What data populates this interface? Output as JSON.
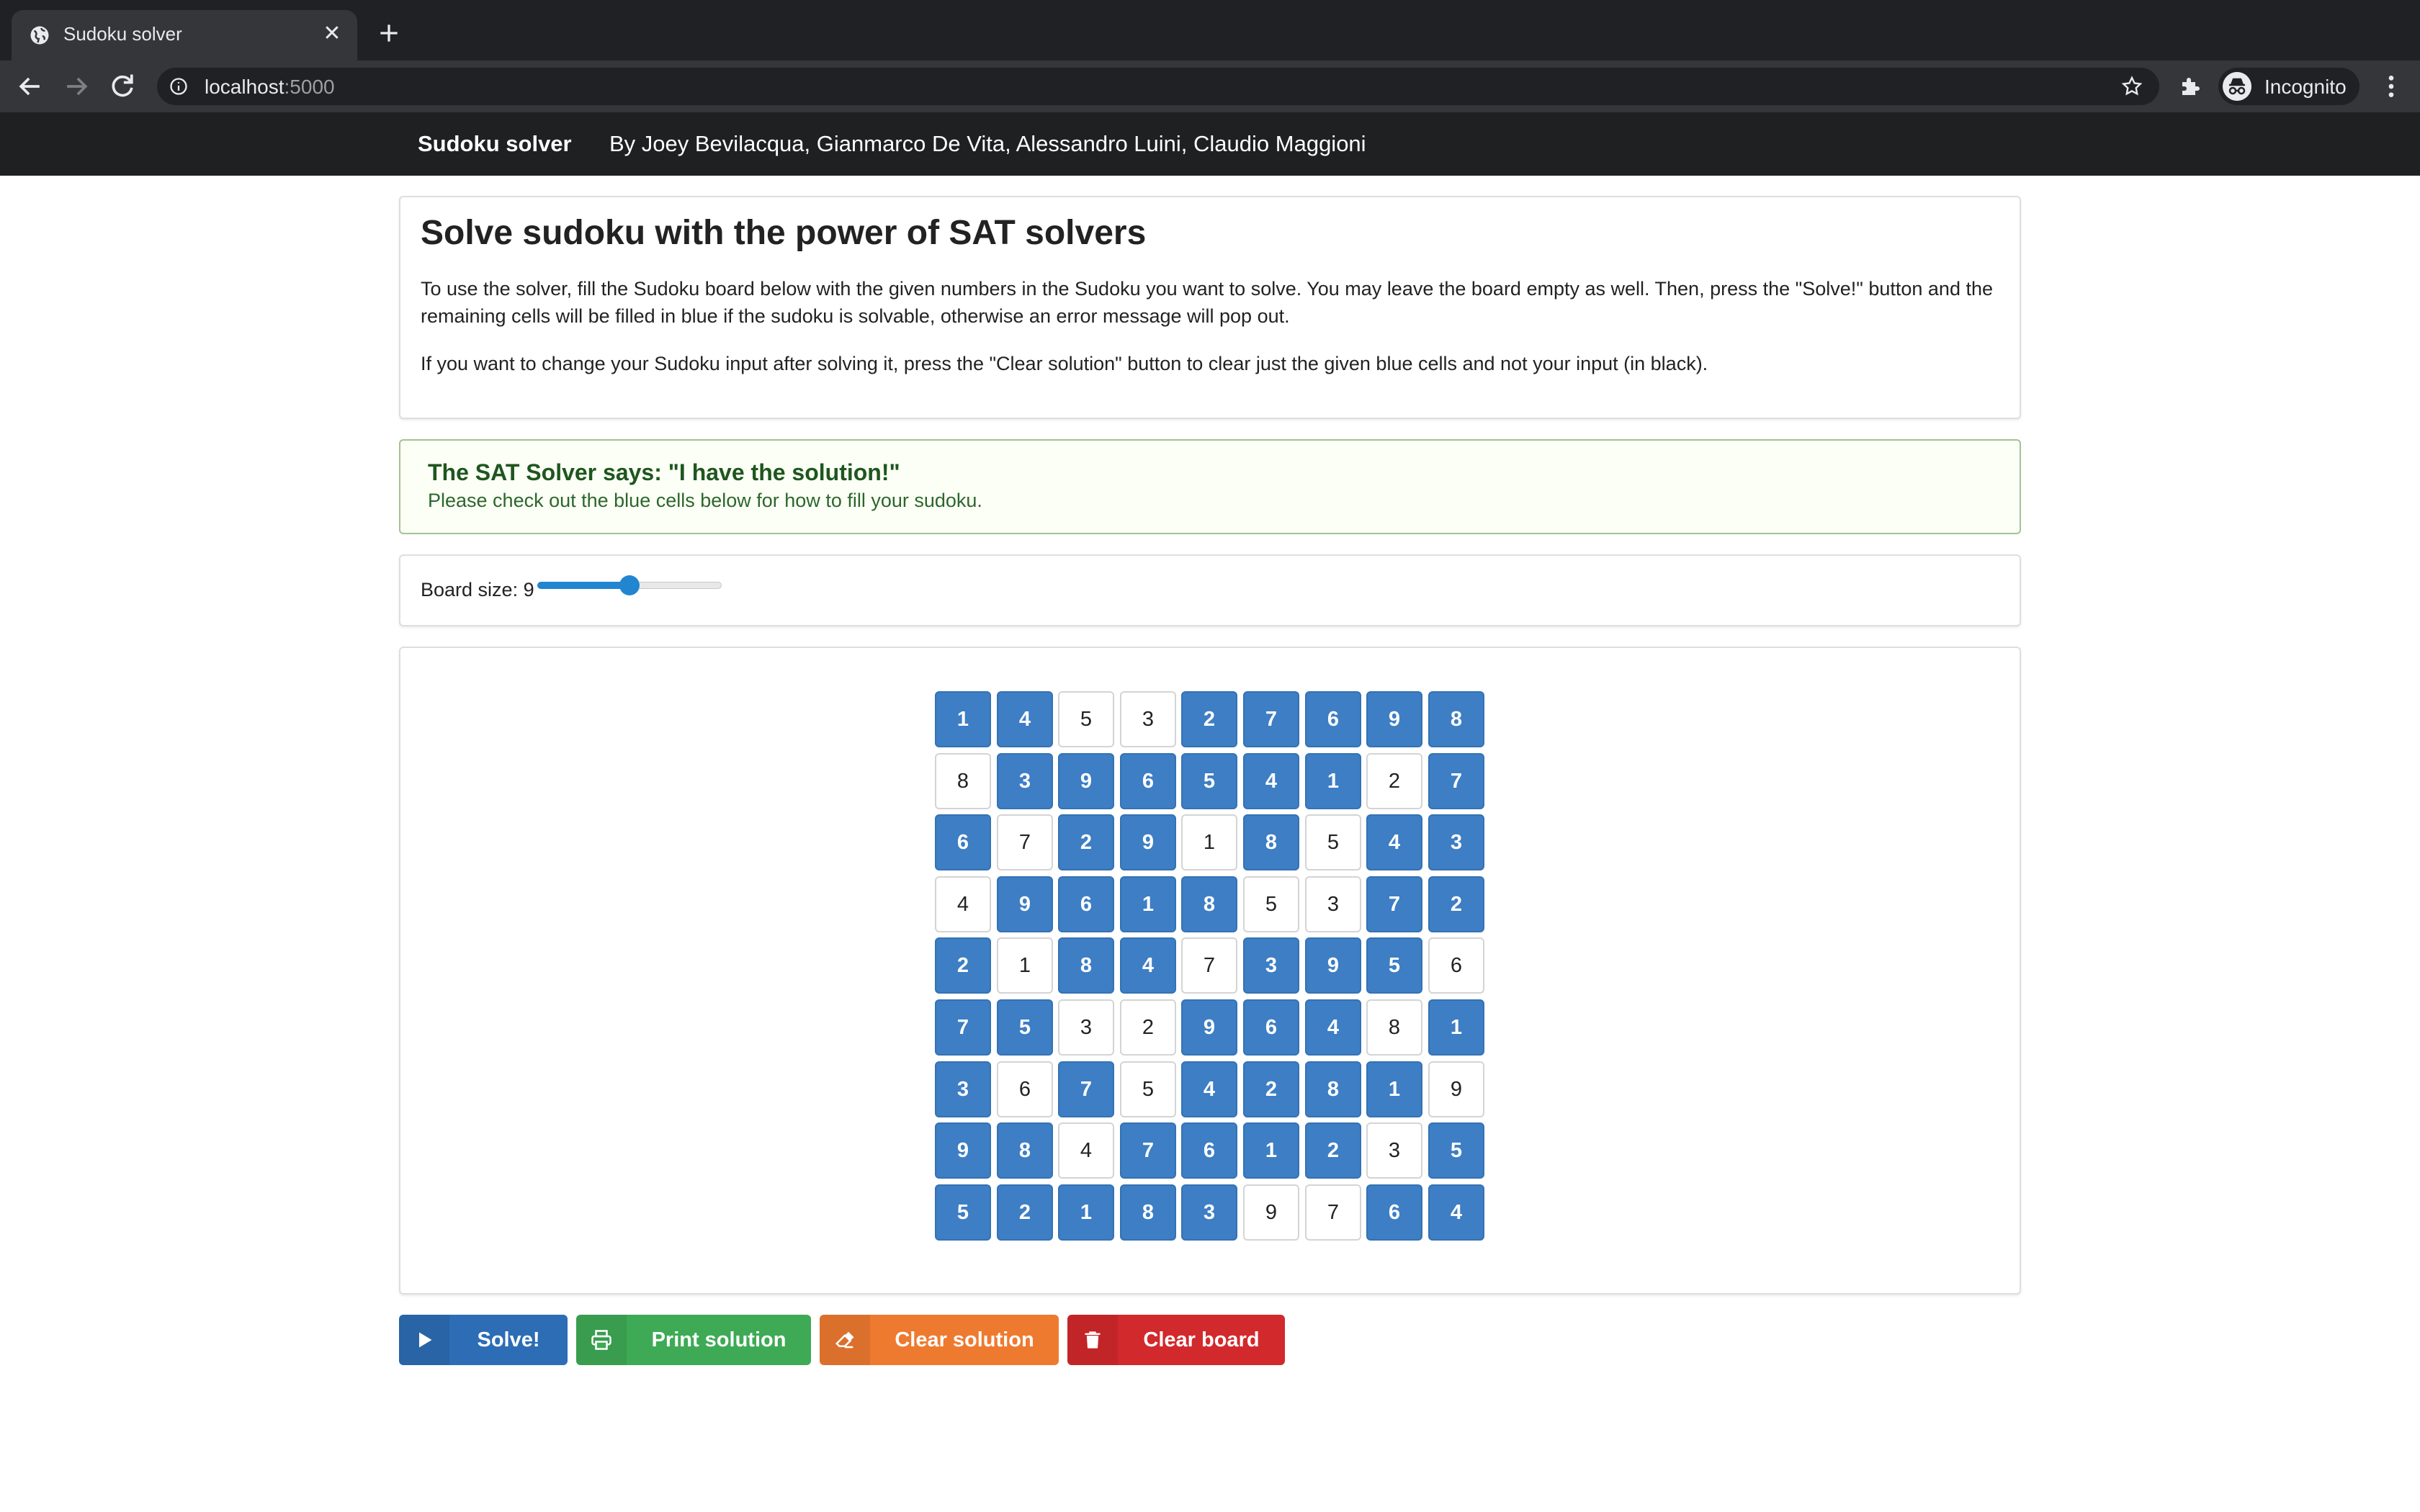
{
  "browser": {
    "tab_title": "Sudoku solver",
    "url_host": "localhost",
    "url_port": ":5000",
    "profile_label": "Incognito",
    "icons": [
      "globe-icon",
      "close-icon",
      "plus-icon",
      "back-icon",
      "forward-icon",
      "reload-icon",
      "info-icon",
      "star-icon",
      "puzzle-icon",
      "incognito-icon",
      "more-vert-icon"
    ]
  },
  "navbar": {
    "brand": "Sudoku solver",
    "authors": "By Joey Bevilacqua, Gianmarco De Vita, Alessandro Luini, Claudio Maggioni"
  },
  "intro": {
    "title": "Solve sudoku with the power of SAT solvers",
    "paragraph1": "To use the solver, fill the Sudoku board below with the given numbers in the Sudoku you want to solve. You may leave the board empty as well. Then, press the \"Solve!\" button and the remaining cells will be filled in blue if the sudoku is solvable, otherwise an error message will pop out.",
    "paragraph2": "If you want to change your Sudoku input after solving it, press the \"Clear solution\" button to clear just the given blue cells and not your input (in black)."
  },
  "alert": {
    "title": "The SAT Solver says: \"I have the solution!\"",
    "message": "Please check out the blue cells below for how to fill your sudoku."
  },
  "board_size": {
    "label": "Board size: 9",
    "value": 9,
    "slider_fraction": 0.5
  },
  "board": {
    "size": 9,
    "values": [
      [
        1,
        4,
        5,
        3,
        2,
        7,
        6,
        9,
        8
      ],
      [
        8,
        3,
        9,
        6,
        5,
        4,
        1,
        2,
        7
      ],
      [
        6,
        7,
        2,
        9,
        1,
        8,
        5,
        4,
        3
      ],
      [
        4,
        9,
        6,
        1,
        8,
        5,
        3,
        7,
        2
      ],
      [
        2,
        1,
        8,
        4,
        7,
        3,
        9,
        5,
        6
      ],
      [
        7,
        5,
        3,
        2,
        9,
        6,
        4,
        8,
        1
      ],
      [
        3,
        6,
        7,
        5,
        4,
        2,
        8,
        1,
        9
      ],
      [
        9,
        8,
        4,
        7,
        6,
        1,
        2,
        3,
        5
      ],
      [
        5,
        2,
        1,
        8,
        3,
        9,
        7,
        6,
        4
      ]
    ],
    "given": [
      [
        0,
        0,
        1,
        1,
        0,
        0,
        0,
        0,
        0
      ],
      [
        1,
        0,
        0,
        0,
        0,
        0,
        0,
        1,
        0
      ],
      [
        0,
        1,
        0,
        0,
        1,
        0,
        1,
        0,
        0
      ],
      [
        1,
        0,
        0,
        0,
        0,
        1,
        1,
        0,
        0
      ],
      [
        0,
        1,
        0,
        0,
        1,
        0,
        0,
        0,
        1
      ],
      [
        0,
        0,
        1,
        1,
        0,
        0,
        0,
        1,
        0
      ],
      [
        0,
        1,
        0,
        1,
        0,
        0,
        0,
        0,
        1
      ],
      [
        0,
        0,
        1,
        0,
        0,
        0,
        0,
        1,
        0
      ],
      [
        0,
        0,
        0,
        0,
        0,
        1,
        1,
        0,
        0
      ]
    ],
    "colors": {
      "solved": "#3d7ec4",
      "given": "#ffffff"
    }
  },
  "buttons": {
    "solve": {
      "label": "Solve!",
      "icon": "play-icon",
      "color": "#2c6db5"
    },
    "print": {
      "label": "Print solution",
      "icon": "print-icon",
      "color": "#3eaa55"
    },
    "clear_solution": {
      "label": "Clear solution",
      "icon": "eraser-icon",
      "color": "#ee7a30"
    },
    "clear_board": {
      "label": "Clear board",
      "icon": "trash-icon",
      "color": "#d2292c"
    }
  }
}
